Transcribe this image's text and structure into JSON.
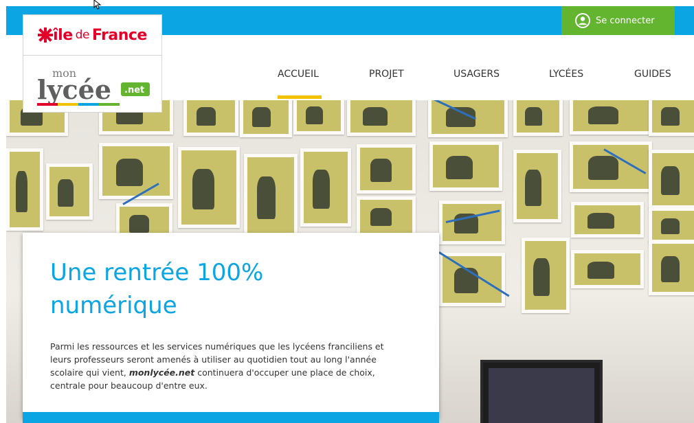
{
  "header": {
    "login_label": "Se connecter",
    "brand_top": "îledeFrance",
    "brand_top_parts": {
      "ile": "île",
      "de": "de",
      "france": "France"
    },
    "brand_bottom_parts": {
      "mon": "mon",
      "lycee": "lycée",
      "net": ".net"
    }
  },
  "nav": {
    "items": [
      {
        "label": "ACCUEIL"
      },
      {
        "label": "PROJET"
      },
      {
        "label": "USAGERS"
      },
      {
        "label": "LYCÉES"
      },
      {
        "label": "GUIDES"
      }
    ]
  },
  "hero": {
    "title_line1": "Une rentrée 100%",
    "title_line2": "numérique",
    "text_before": "Parmi les ressources et les services numériques que les lycéens franciliens et leurs professeurs seront amenés à utiliser au quotidien tout au long l'année scolaire qui vient, ",
    "text_brand": "monlycée.net",
    "text_after": " continuera d'occuper une place de choix, centrale pour beaucoup d'entre eux."
  },
  "colors": {
    "primary_blue": "#0aa5e2",
    "login_green": "#63b52f",
    "idf_red": "#e2002a",
    "nav_active": "#f2c200"
  }
}
